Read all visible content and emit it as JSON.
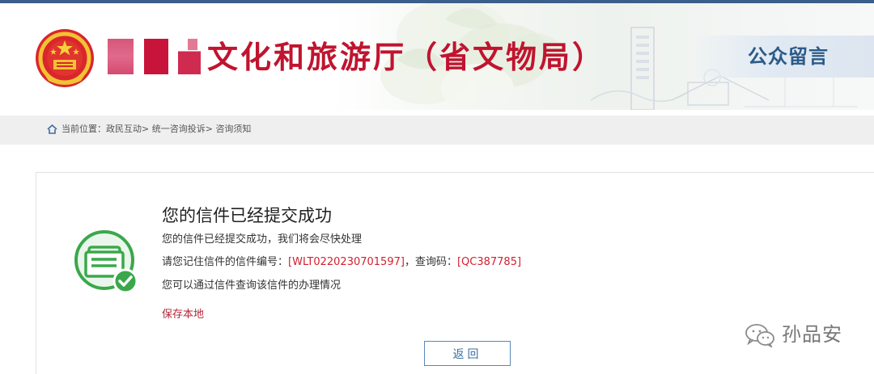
{
  "header": {
    "agency_name": "文化和旅游厅（省文物局）",
    "section_title": "公众留言"
  },
  "breadcrumb": {
    "prefix": "当前位置：",
    "items": [
      "政民互动",
      "统一咨询投诉",
      "咨询须知"
    ],
    "separator": ">"
  },
  "result": {
    "title": "您的信件已经提交成功",
    "message": "您的信件已经提交成功，我们将会尽快处理",
    "remember_prefix": "请您记住信件的信件编号：",
    "letter_number": "[WLT0220230701597]",
    "query_label": "，查询码：",
    "query_code": "[QC387785]",
    "hint": "您可以通过信件查询该信件的办理情况",
    "save_link": "保存本地",
    "back_button": "返回"
  },
  "watermark": {
    "text": "孙品安"
  },
  "colors": {
    "brand_red": "#c0142f",
    "accent_blue": "#3b6ea3",
    "success_green": "#3aa84a",
    "highlight_red": "#d2202f"
  },
  "icons": {
    "emblem": "national-emblem-icon",
    "home": "home-icon",
    "success": "letter-success-icon",
    "watermark": "wechat-icon"
  }
}
